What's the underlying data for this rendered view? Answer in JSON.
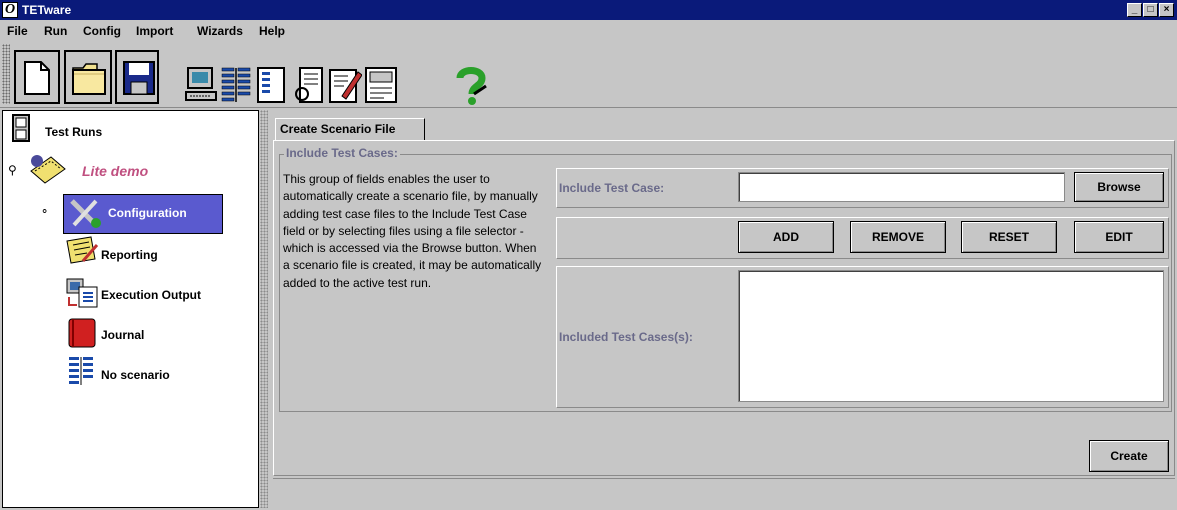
{
  "window": {
    "title": "TETware",
    "logo_glyph": "O",
    "minimize": "_",
    "maximize": "□",
    "close": "×"
  },
  "menu": [
    "File",
    "Run",
    "Config",
    "Import",
    "Wizards",
    "Help"
  ],
  "toolbar": {
    "icons": [
      "new-document-icon",
      "open-folder-icon",
      "save-disk-icon",
      "computer-icon",
      "scenario-icon",
      "scenario-list-icon",
      "journal-icon",
      "edit-document-icon",
      "report-icon",
      "help-icon"
    ]
  },
  "tree": {
    "root": "Test Runs",
    "run": "Lite demo",
    "items": [
      "Configuration",
      "Reporting",
      "Execution Output",
      "Journal",
      "No scenario"
    ]
  },
  "tab": {
    "label": "Create Scenario File"
  },
  "group": {
    "title": "Include Test Cases:",
    "description": "This group of fields enables the user to automatically create a scenario file, by manually adding test case files to the Include Test Case field or by selecting files using a file selector - which is accessed via the Browse button. When a scenario file is created, it may be automatically added to the active test run."
  },
  "form": {
    "include_label": "Include Test Case:",
    "include_value": "",
    "browse_label": "Browse",
    "add_label": "ADD",
    "remove_label": "REMOVE",
    "reset_label": "RESET",
    "edit_label": "EDIT",
    "included_label": "Included Test Cases(s):",
    "create_label": "Create"
  },
  "colors": {
    "titlebar": "#0a1a7a",
    "panel": "#c6c6c6",
    "selected": "#5a5acf",
    "run_text": "#c05080",
    "label_text": "#6a6a8a"
  }
}
